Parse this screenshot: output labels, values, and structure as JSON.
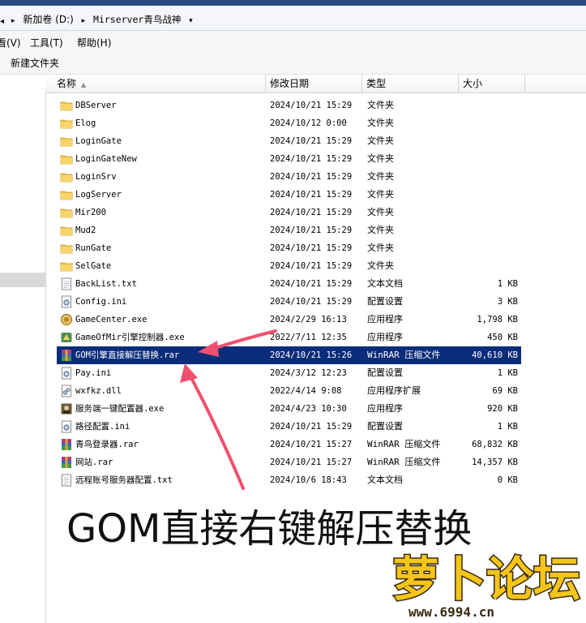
{
  "address": {
    "crumbs": [
      "新加卷 (D:)",
      "Mirserver青鸟战神"
    ],
    "separator": "▸",
    "dropdown": "▾"
  },
  "menu": {
    "view": "看(V)",
    "tools": "工具(T)",
    "help": "帮助(H)"
  },
  "toolbar": {
    "new_folder": "新建文件夹"
  },
  "columns": {
    "name": "名称",
    "date": "修改日期",
    "type": "类型",
    "size": "大小"
  },
  "files": [
    {
      "name": "DBServer",
      "date": "2024/10/21 15:29",
      "type": "文件夹",
      "size": "",
      "icon": "folder-icon"
    },
    {
      "name": "Elog",
      "date": "2024/10/12 0:00",
      "type": "文件夹",
      "size": "",
      "icon": "folder-icon"
    },
    {
      "name": "LoginGate",
      "date": "2024/10/21 15:29",
      "type": "文件夹",
      "size": "",
      "icon": "folder-icon"
    },
    {
      "name": "LoginGateNew",
      "date": "2024/10/21 15:29",
      "type": "文件夹",
      "size": "",
      "icon": "folder-icon"
    },
    {
      "name": "LoginSrv",
      "date": "2024/10/21 15:29",
      "type": "文件夹",
      "size": "",
      "icon": "folder-icon"
    },
    {
      "name": "LogServer",
      "date": "2024/10/21 15:29",
      "type": "文件夹",
      "size": "",
      "icon": "folder-icon"
    },
    {
      "name": "Mir200",
      "date": "2024/10/21 15:29",
      "type": "文件夹",
      "size": "",
      "icon": "folder-icon"
    },
    {
      "name": "Mud2",
      "date": "2024/10/21 15:29",
      "type": "文件夹",
      "size": "",
      "icon": "folder-icon"
    },
    {
      "name": "RunGate",
      "date": "2024/10/21 15:29",
      "type": "文件夹",
      "size": "",
      "icon": "folder-icon"
    },
    {
      "name": "SelGate",
      "date": "2024/10/21 15:29",
      "type": "文件夹",
      "size": "",
      "icon": "folder-icon"
    },
    {
      "name": "BackList.txt",
      "date": "2024/10/21 15:29",
      "type": "文本文档",
      "size": "1 KB",
      "icon": "text-file-icon"
    },
    {
      "name": "Config.ini",
      "date": "2024/10/21 15:29",
      "type": "配置设置",
      "size": "3 KB",
      "icon": "ini-file-icon"
    },
    {
      "name": "GameCenter.exe",
      "date": "2024/2/29 16:13",
      "type": "应用程序",
      "size": "1,798 KB",
      "icon": "gamecenter-exe-icon"
    },
    {
      "name": "GameOfMir引擎控制器.exe",
      "date": "2022/7/11 12:35",
      "type": "应用程序",
      "size": "450 KB",
      "icon": "engine-exe-icon"
    },
    {
      "name": "GOM引擎直接解压替换.rar",
      "date": "2024/10/21 15:26",
      "type": "WinRAR 压缩文件",
      "size": "40,610 KB",
      "icon": "winrar-archive-icon",
      "selected": true
    },
    {
      "name": "Pay.ini",
      "date": "2024/3/12 12:23",
      "type": "配置设置",
      "size": "1 KB",
      "icon": "ini-file-icon"
    },
    {
      "name": "wxfkz.dll",
      "date": "2022/4/14 9:08",
      "type": "应用程序扩展",
      "size": "69 KB",
      "icon": "dll-file-icon"
    },
    {
      "name": "服务端一键配置器.exe",
      "date": "2024/4/23 10:30",
      "type": "应用程序",
      "size": "920 KB",
      "icon": "config-exe-icon"
    },
    {
      "name": "路径配置.ini",
      "date": "2024/10/21 15:29",
      "type": "配置设置",
      "size": "1 KB",
      "icon": "ini-file-icon"
    },
    {
      "name": "青鸟登录器.rar",
      "date": "2024/10/21 15:27",
      "type": "WinRAR 压缩文件",
      "size": "68,832 KB",
      "icon": "winrar-archive-icon"
    },
    {
      "name": "网站.rar",
      "date": "2024/10/21 15:27",
      "type": "WinRAR 压缩文件",
      "size": "14,357 KB",
      "icon": "winrar-archive-icon"
    },
    {
      "name": "远程账号服务器配置.txt",
      "date": "2024/10/6 18:43",
      "type": "文本文档",
      "size": "0 KB",
      "icon": "text-file-icon"
    }
  ],
  "annotation": "GOM直接右键解压替换",
  "watermark": {
    "brand": "萝卜论坛",
    "url": "www.6994.cn"
  },
  "colors": {
    "selection": "#0b2c7a",
    "arrow": "#f0506e",
    "folder": "#f2c14e"
  }
}
